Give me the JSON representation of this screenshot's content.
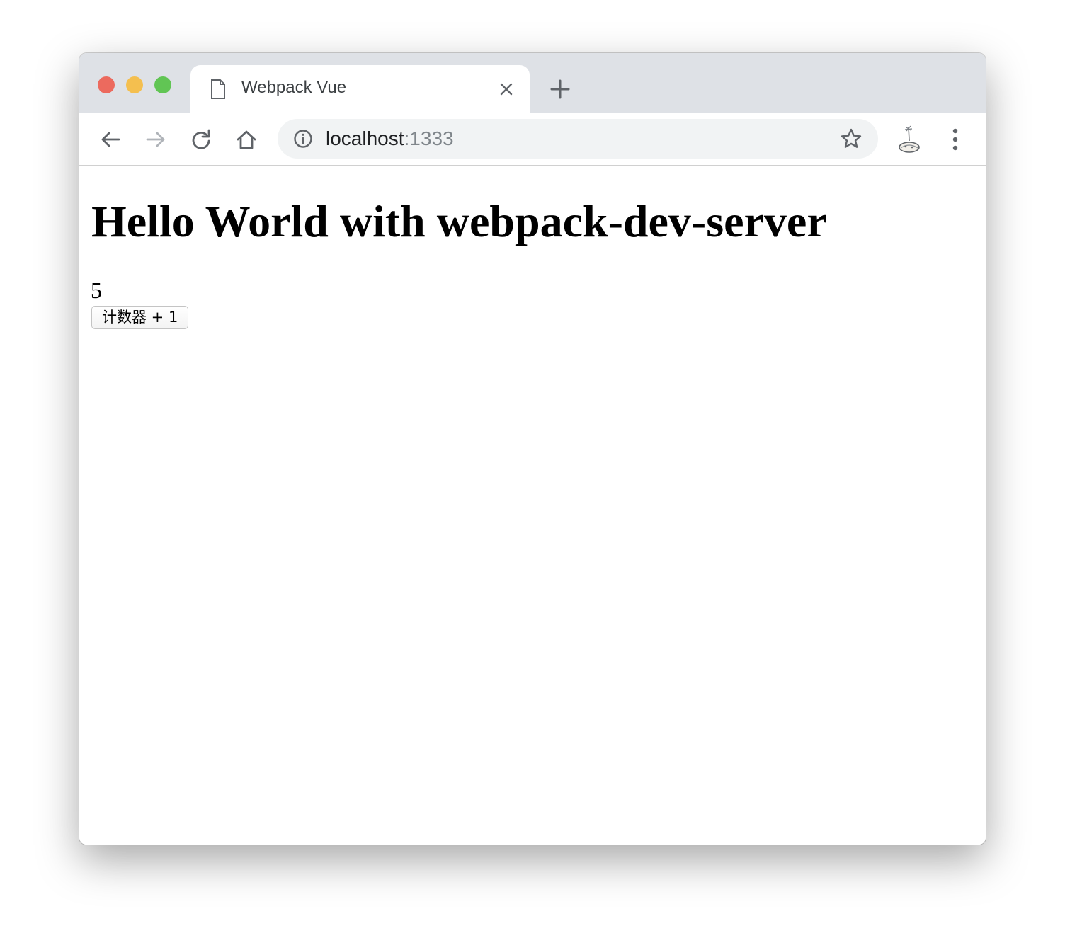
{
  "browser": {
    "traffic_lights": {
      "close_color": "#ec6a5e",
      "minimize_color": "#f4bf4f",
      "maximize_color": "#61c554"
    },
    "tab": {
      "title": "Webpack Vue",
      "favicon": "page-icon",
      "close_icon": "close-icon"
    },
    "new_tab_icon": "plus-icon",
    "nav": {
      "back_icon": "back-arrow-icon",
      "forward_icon": "forward-arrow-icon",
      "reload_icon": "reload-icon",
      "home_icon": "home-icon"
    },
    "address_bar": {
      "host": "localhost",
      "port": ":1333",
      "info_icon": "info-icon",
      "bookmark_icon": "star-icon"
    },
    "extension_icon": "extension-icon",
    "menu_icon": "more-vertical-icon"
  },
  "page": {
    "heading": "Hello World with webpack-dev-server",
    "counter_value": "5",
    "counter_button_label": "计数器 + 1"
  }
}
